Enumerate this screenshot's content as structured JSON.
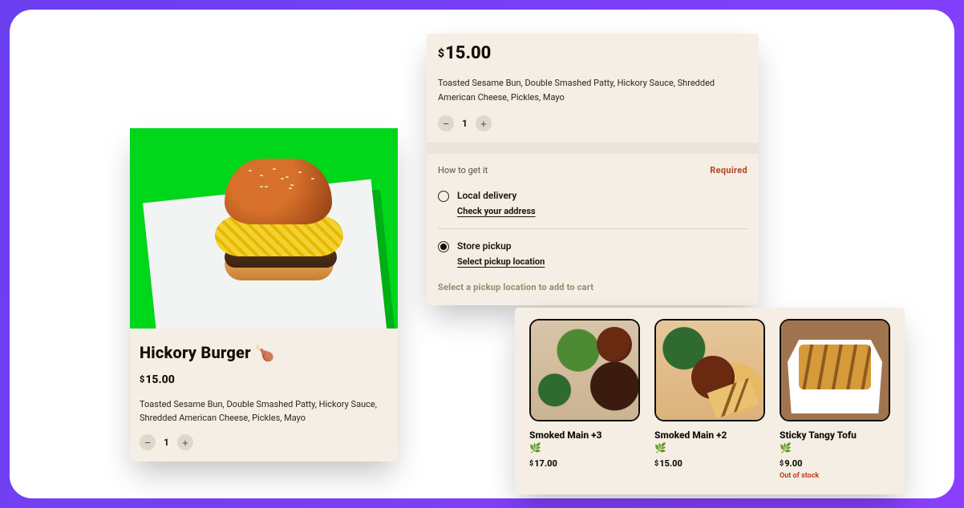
{
  "product": {
    "title": "Hickory Burger 🍗",
    "currency": "$",
    "price": "15.00",
    "description": "Toasted Sesame Bun, Double Smashed Patty, Hickory Sauce, Shredded American Cheese, Pickles, Mayo",
    "qty": "1"
  },
  "fulfillment": {
    "currency": "$",
    "price": "15.00",
    "description": "Toasted Sesame Bun, Double Smashed Patty, Hickory Sauce, Shredded American Cheese, Pickles, Mayo",
    "qty": "1",
    "section_label": "How to get it",
    "required_label": "Required",
    "options": [
      {
        "label": "Local delivery",
        "action": "Check your address",
        "selected": false
      },
      {
        "label": "Store pickup",
        "action": "Select pickup location",
        "selected": true
      }
    ],
    "hint": "Select a pickup location to add to cart"
  },
  "related": [
    {
      "name": "Smoked Main +3",
      "vegan": true,
      "currency": "$",
      "price": "17.00",
      "out_of_stock": false
    },
    {
      "name": "Smoked Main +2",
      "vegan": true,
      "currency": "$",
      "price": "15.00",
      "out_of_stock": false
    },
    {
      "name": "Sticky Tangy Tofu",
      "vegan": true,
      "currency": "$",
      "price": "9.00",
      "out_of_stock": true
    }
  ],
  "labels": {
    "out_of_stock": "Out of stock",
    "leaf": "🌿"
  }
}
